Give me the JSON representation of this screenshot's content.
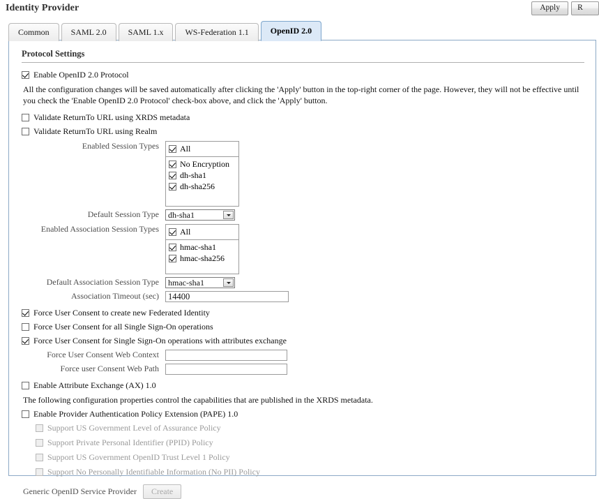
{
  "header": {
    "title": "Identity Provider",
    "apply_label": "Apply",
    "secondary_label": "R"
  },
  "tabs": [
    {
      "label": "Common",
      "active": false
    },
    {
      "label": "SAML 2.0",
      "active": false
    },
    {
      "label": "SAML 1.x",
      "active": false
    },
    {
      "label": "WS-Federation 1.1",
      "active": false
    },
    {
      "label": "OpenID 2.0",
      "active": true
    }
  ],
  "section": {
    "title": "Protocol Settings"
  },
  "enable_protocol": {
    "label": "Enable OpenID 2.0 Protocol",
    "checked": true
  },
  "notice": "All the configuration changes will be saved automatically after clicking the 'Apply' button in the top-right corner of the page. However, they will not be effective until you check the 'Enable OpenID 2.0 Protocol' check-box above, and click the 'Apply' button.",
  "validate": [
    {
      "label": "Validate ReturnTo URL using XRDS metadata",
      "checked": false
    },
    {
      "label": "Validate ReturnTo URL using Realm",
      "checked": false
    }
  ],
  "session_types": {
    "label": "Enabled Session Types",
    "all": {
      "label": "All",
      "checked": true
    },
    "options": [
      {
        "label": "No Encryption",
        "checked": true
      },
      {
        "label": "dh-sha1",
        "checked": true
      },
      {
        "label": "dh-sha256",
        "checked": true
      }
    ]
  },
  "default_session_type": {
    "label": "Default Session Type",
    "value": "dh-sha1"
  },
  "assoc_session_types": {
    "label": "Enabled Association Session Types",
    "all": {
      "label": "All",
      "checked": true
    },
    "options": [
      {
        "label": "hmac-sha1",
        "checked": true
      },
      {
        "label": "hmac-sha256",
        "checked": true
      }
    ]
  },
  "default_assoc_session_type": {
    "label": "Default Association Session Type",
    "value": "hmac-sha1"
  },
  "assoc_timeout": {
    "label": "Association Timeout (sec)",
    "value": "14400",
    "placeholder": ""
  },
  "consent": [
    {
      "label": "Force User Consent to create new Federated Identity",
      "checked": true
    },
    {
      "label": "Force User Consent for all Single Sign-On operations",
      "checked": false
    },
    {
      "label": "Force User Consent for Single Sign-On operations with attributes exchange",
      "checked": true
    }
  ],
  "consent_web_context": {
    "label": "Force User Consent Web Context",
    "value": "",
    "placeholder": ""
  },
  "consent_web_path": {
    "label": "Force user Consent Web Path",
    "value": "",
    "placeholder": ""
  },
  "attribute_exchange": {
    "label": "Enable Attribute Exchange (AX) 1.0",
    "checked": false
  },
  "xrds_note": "The following configuration properties control the capabilities that are published in the XRDS metadata.",
  "pape": {
    "label": "Enable Provider Authentication Policy Extension (PAPE) 1.0",
    "checked": false,
    "sub_options": [
      {
        "label": "Support US Government Level of Assurance Policy",
        "checked": false,
        "disabled": true
      },
      {
        "label": "Support Private Personal Identifier (PPID) Policy",
        "checked": false,
        "disabled": true
      },
      {
        "label": "Support US Government OpenID Trust Level 1 Policy",
        "checked": false,
        "disabled": true
      },
      {
        "label": "Support No Personally Identifiable Information (No PII) Policy",
        "checked": false,
        "disabled": true
      }
    ]
  },
  "service_provider": {
    "label": "Generic OpenID Service Provider",
    "button_label": "Create",
    "button_disabled": true
  },
  "colors": {
    "active_tab_bg": "#dce9f7",
    "active_tab_border": "#7ea6cc",
    "panel_border": "#8ca9c6",
    "disabled_text": "#9a9a9a",
    "label_text": "#4e4e4e"
  }
}
